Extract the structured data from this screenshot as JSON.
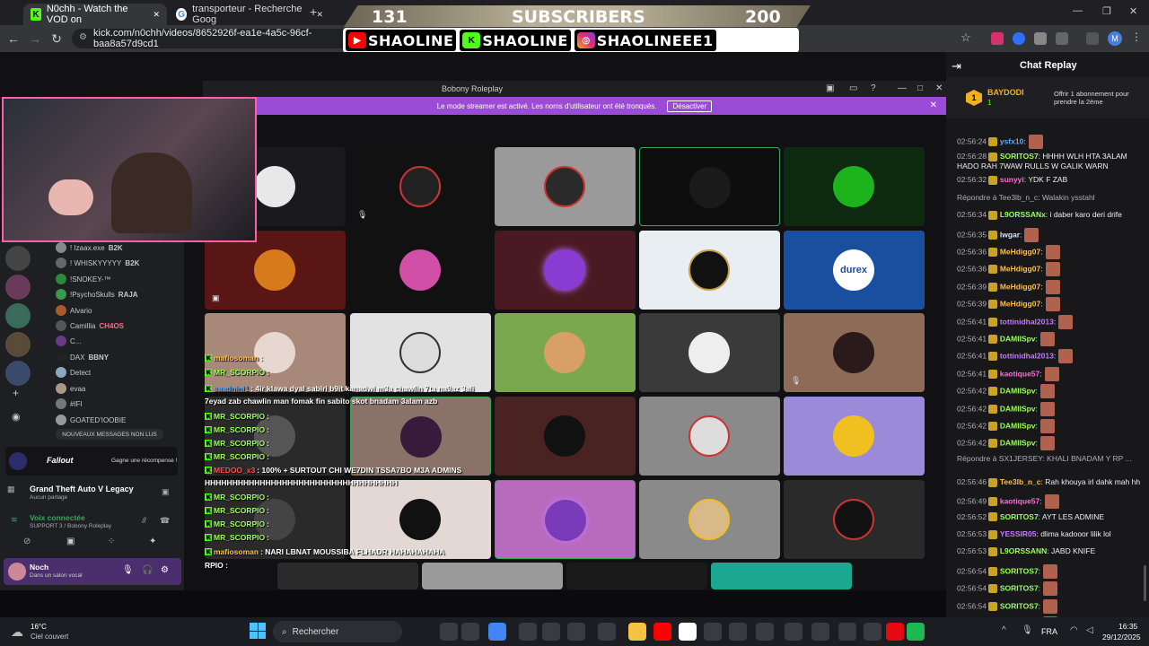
{
  "browser": {
    "tabs": [
      {
        "title": "N0chh - Watch the VOD on"
      },
      {
        "title": "transporteur - Recherche Goog"
      }
    ],
    "url": "kick.com/n0chh/videos/8652926f-ea1e-4a5c-96cf-baa8a57d9cd1",
    "new_tab_glyph": "+",
    "window_controls": [
      "—",
      "❐",
      "✕"
    ],
    "profile_letter": "M"
  },
  "overlay": {
    "sub_left": "131",
    "sub_label": "SUBSCRIBERS",
    "sub_right": "200",
    "socials": [
      {
        "icon": "youtube-icon",
        "name": "SHAOLINE",
        "color": "#ff0000"
      },
      {
        "icon": "kick-icon",
        "name": "SHAOLINE",
        "color": "#53fc18"
      },
      {
        "icon": "instagram-icon",
        "name": "SHAOLINEEE1",
        "color": "#e1306c"
      }
    ]
  },
  "discord": {
    "title": "Bobony Roleplay",
    "streamer_notice": "Le mode streamer est activé. Les noms d'utilisateur ont été tronqués.",
    "disable_button": "Désactiver",
    "members": [
      {
        "name": "! Izaax.exe",
        "badge": "B2K"
      },
      {
        "name": "! WHISKYYYYY",
        "badge": "B2K"
      },
      {
        "name": "!SNOKEY-™",
        "badge": ""
      },
      {
        "name": "!PsychoSkulls",
        "badge": "RAJA"
      },
      {
        "name": "Alvario",
        "badge": ""
      },
      {
        "name": "Camillia",
        "badge": "CH4OS"
      },
      {
        "name": "C...",
        "badge": ""
      },
      {
        "name": "DAX",
        "badge": "BBNY"
      },
      {
        "name": "Detect",
        "badge": ""
      },
      {
        "name": "evaa",
        "badge": ""
      },
      {
        "name": "#IFI",
        "badge": ""
      },
      {
        "name": "GOATED'IOOBIE",
        "badge": ""
      }
    ],
    "new_messages": "NOUVEAUX MESSAGES NON LUS",
    "fallout_label": "Fallout",
    "reward_label": "Gagne une récompense !",
    "game_title": "Grand Theft Auto V Legacy",
    "game_sub": "Aucun partage",
    "voice_status": "Voix connectée",
    "voice_sub": "SUPPORT 3 / Bobony Roleplay",
    "user_name": "Noch",
    "user_status": "Dans un salon vocal"
  },
  "overlay_chat": [
    {
      "user": "mafiosoman",
      "text": ":"
    },
    {
      "user": "MR_SCORPIO",
      "text": ":"
    },
    {
      "user": "saadnini1",
      "text": ": 4ir klawa dyal sabiri b9it kanadwi m3a chawlin 7ta na9az 3ali"
    },
    {
      "user": "",
      "text": "7eyad zab chawlin man fomak fin sabito skot bnadam 3alam azb"
    },
    {
      "user": "MR_SCORPIO",
      "text": ":"
    },
    {
      "user": "MR_SCORPIO",
      "text": ":"
    },
    {
      "user": "MR_SCORPIO",
      "text": ":"
    },
    {
      "user": "MR_SCORPIO",
      "text": ":"
    },
    {
      "user": "MEDOO_x3",
      "text": ": 100% + SURTOUT CHI WE7DIN TSSA7BO M3A ADMINS"
    },
    {
      "user": "",
      "text": "HHHHHHHHHHHHHHHHHHHHHHHHHHHHHHHHHHH"
    },
    {
      "user": "MR_SCORPIO",
      "text": ":"
    },
    {
      "user": "MR_SCORPIO",
      "text": ":"
    },
    {
      "user": "MR_SCORPIO",
      "text": ":"
    },
    {
      "user": "MR_SCORPIO",
      "text": ":"
    },
    {
      "user": "mafiosoman",
      "text": ": NARI LBNAT MOUSSIBA FLHADR HAHAHAHAHA"
    },
    {
      "user": "",
      "text": "RPIO :"
    }
  ],
  "chat": {
    "title": "Chat Replay",
    "pinned_user": "BAYDODI",
    "pinned_count": "1",
    "pinned_gift": "Offrir 1 abonnement pour prendre la 2ème",
    "messages": [
      {
        "time": "02:56:24",
        "user": "ysfx10",
        "color": "#5aa9ff",
        "text": ":"
      },
      {
        "time": "02:56:28",
        "user": "SORITOS7",
        "color": "#9aff5a",
        "text": ": HHHH WLH HTA 3ALAM HADO RAH 7WAW RULLS W GALIK WARN"
      },
      {
        "time": "02:56:32",
        "user": "sunyyi",
        "color": "#ff6bd5",
        "text": ": YDK F ZAB"
      },
      {
        "time": "",
        "user": "",
        "color": "#adadb8",
        "text": "Répondre à Tee3lb_n_c: Walakin ysstahl"
      },
      {
        "time": "02:56:34",
        "user": "L9ORSSANx",
        "color": "#9aff5a",
        "text": ": i daber karo deri drife"
      },
      {
        "time": "02:56:35",
        "user": "lwgar",
        "color": "#d7e3ff",
        "text": ":"
      },
      {
        "time": "02:56:36",
        "user": "MeHdigg07",
        "color": "#ffbf4d",
        "text": ":"
      },
      {
        "time": "02:56:36",
        "user": "MeHdigg07",
        "color": "#ffbf4d",
        "text": ":"
      },
      {
        "time": "02:56:39",
        "user": "MeHdigg07",
        "color": "#ffbf4d",
        "text": ":"
      },
      {
        "time": "02:56:39",
        "user": "MeHdigg07",
        "color": "#ffbf4d",
        "text": ":"
      },
      {
        "time": "02:56:41",
        "user": "tottinidhal2013",
        "color": "#c47bff",
        "text": ":"
      },
      {
        "time": "02:56:41",
        "user": "DAMIISpv",
        "color": "#9aff5a",
        "text": ":"
      },
      {
        "time": "02:56:41",
        "user": "tottinidhal2013",
        "color": "#c47bff",
        "text": ":"
      },
      {
        "time": "02:56:41",
        "user": "kaotique57",
        "color": "#ff6bd5",
        "text": ":"
      },
      {
        "time": "02:56:42",
        "user": "DAMIISpv",
        "color": "#9aff5a",
        "text": ":"
      },
      {
        "time": "02:56:42",
        "user": "DAMIISpv",
        "color": "#9aff5a",
        "text": ":"
      },
      {
        "time": "02:56:42",
        "user": "DAMIISpv",
        "color": "#9aff5a",
        "text": ":"
      },
      {
        "time": "02:56:42",
        "user": "DAMIISpv",
        "color": "#9aff5a",
        "text": ":"
      },
      {
        "time": "",
        "user": "",
        "color": "#adadb8",
        "text": "Répondre à SX1JERSEY: KHALI BNADAM Y RP ..."
      },
      {
        "time": "02:56:46",
        "user": "Tee3lb_n_c",
        "color": "#ffbf4d",
        "text": ": Rah khouya irl dahk mah hh"
      },
      {
        "time": "02:56:49",
        "user": "kaotique57",
        "color": "#ff6bd5",
        "text": ":"
      },
      {
        "time": "02:56:52",
        "user": "SORITOS7",
        "color": "#9aff5a",
        "text": ": AYT LES ADMINE"
      },
      {
        "time": "02:56:53",
        "user": "YESSIR05",
        "color": "#c47bff",
        "text": ": dlima kadooor lilik lol"
      },
      {
        "time": "02:56:53",
        "user": "L9ORSSANN",
        "color": "#9aff5a",
        "text": ": JABD KNIFE"
      },
      {
        "time": "02:56:54",
        "user": "SORITOS7",
        "color": "#9aff5a",
        "text": ":"
      },
      {
        "time": "02:56:54",
        "user": "SORITOS7",
        "color": "#9aff5a",
        "text": ":"
      },
      {
        "time": "02:56:54",
        "user": "SORITOS7",
        "color": "#9aff5a",
        "text": ":"
      },
      {
        "time": "02:56:55",
        "user": "SORITOS7",
        "color": "#9aff5a",
        "text": ":"
      }
    ]
  },
  "taskbar": {
    "weather_temp": "16°C",
    "weather_desc": "Ciel couvert",
    "search": "Rechercher",
    "lang": "FRA",
    "time": "16:35",
    "date": "29/12/2025",
    "icons": [
      {
        "name": "chrome-icon",
        "color": "#4285f4"
      },
      {
        "name": "file-explorer-icon",
        "color": "#f5c342"
      },
      {
        "name": "youtube-icon",
        "color": "#ff0000"
      },
      {
        "name": "fn-icon",
        "color": "#ffffff"
      },
      {
        "name": "netflix-icon",
        "color": "#e50914"
      },
      {
        "name": "spotify-icon",
        "color": "#1db954"
      }
    ]
  },
  "durex_text": "durex"
}
